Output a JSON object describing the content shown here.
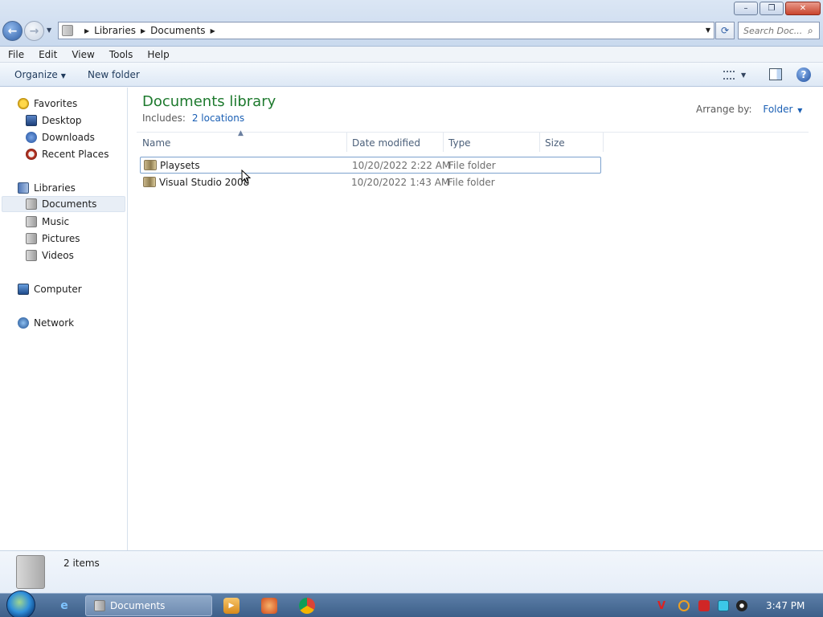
{
  "address": {
    "breadcrumbs": [
      "Libraries",
      "Documents"
    ],
    "search_placeholder": "Search Doc..."
  },
  "window_controls": {
    "minimize": "–",
    "restore": "❐",
    "close": "✕"
  },
  "menu": [
    "File",
    "Edit",
    "View",
    "Tools",
    "Help"
  ],
  "toolbar": {
    "organize": "Organize",
    "new_folder": "New folder",
    "help": "?"
  },
  "nav": {
    "favorites": {
      "label": "Favorites",
      "items": [
        "Desktop",
        "Downloads",
        "Recent Places"
      ]
    },
    "libraries": {
      "label": "Libraries",
      "items": [
        "Documents",
        "Music",
        "Pictures",
        "Videos"
      ],
      "selected": "Documents"
    },
    "computer": "Computer",
    "network": "Network"
  },
  "library": {
    "title": "Documents library",
    "includes_label": "Includes:",
    "includes_link": "2 locations",
    "arrange_label": "Arrange by:",
    "arrange_value": "Folder"
  },
  "columns": [
    "Name",
    "Date modified",
    "Type",
    "Size"
  ],
  "files": [
    {
      "name": "Playsets",
      "date": "10/20/2022 2:22 AM",
      "type": "File folder",
      "size": ""
    },
    {
      "name": "Visual Studio 2008",
      "date": "10/20/2022 1:43 AM",
      "type": "File folder",
      "size": ""
    }
  ],
  "details": {
    "count": "2 items"
  },
  "taskbar": {
    "active_task": "Documents",
    "clock": "3:47 PM"
  },
  "colors": {
    "library_title": "#1e7a2e",
    "link": "#1a5fb4",
    "taskbar": "#3d5f89"
  }
}
